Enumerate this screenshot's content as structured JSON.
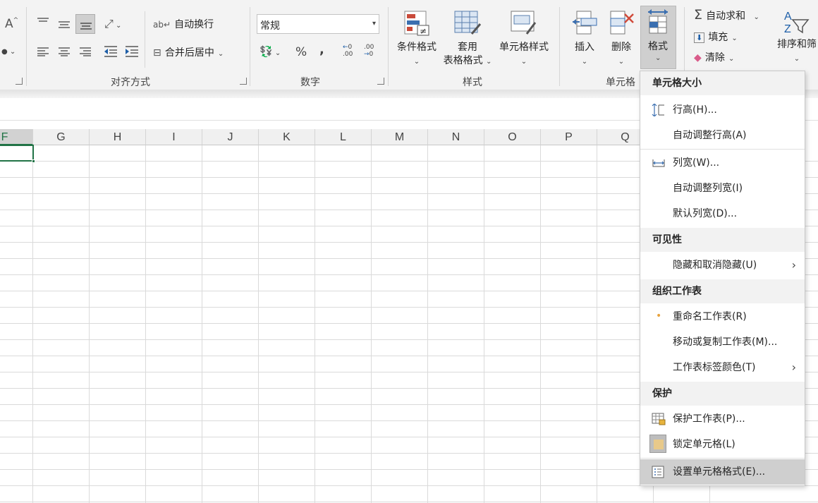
{
  "ribbon": {
    "font_fragment": "A",
    "wrap_text": "自动换行",
    "merge_center": "合并后居中",
    "align_group": "对齐方式",
    "number_format": "常规",
    "percent": "%",
    "comma": ",",
    "dec_increase": ".00",
    "dec_decrease": ".00",
    "number_group": "数字",
    "cond_format": "条件格式",
    "table_format_1": "套用",
    "table_format_2": "表格格式",
    "cell_styles": "单元格样式",
    "styles_group": "样式",
    "insert": "插入",
    "delete": "删除",
    "format": "格式",
    "cells_group": "单元格",
    "autosum": "自动求和",
    "fill": "填充",
    "clear": "清除",
    "sort_filter": "排序和筛"
  },
  "columns": [
    "F",
    "G",
    "H",
    "I",
    "J",
    "K",
    "L",
    "M",
    "N",
    "O",
    "P",
    "Q"
  ],
  "menu": {
    "sec_size": "单元格大小",
    "row_height": "行高(H)...",
    "autofit_row": "自动调整行高(A)",
    "col_width": "列宽(W)...",
    "autofit_col": "自动调整列宽(I)",
    "default_width": "默认列宽(D)...",
    "sec_visibility": "可见性",
    "hide_unhide": "隐藏和取消隐藏(U)",
    "sec_organize": "组织工作表",
    "rename_sheet": "重命名工作表(R)",
    "move_copy": "移动或复制工作表(M)...",
    "tab_color": "工作表标签颜色(T)",
    "sec_protect": "保护",
    "protect_sheet": "保护工作表(P)...",
    "lock_cell": "锁定单元格(L)",
    "format_cells": "设置单元格格式(E)..."
  },
  "colors": {
    "excel_green": "#217346",
    "highlight": "#cfcfcf",
    "bullet": "#e8a33d"
  }
}
